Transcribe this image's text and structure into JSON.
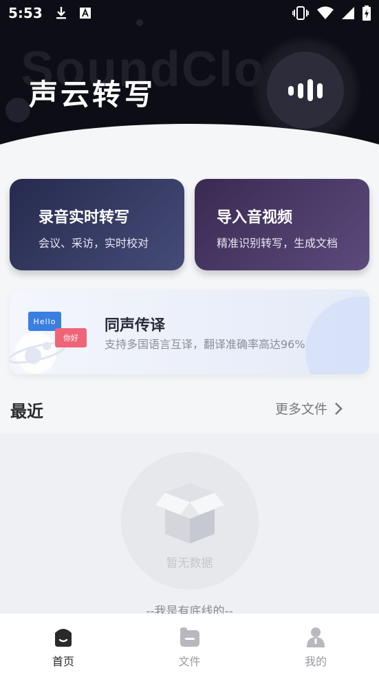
{
  "status_bar": {
    "time": "5:53",
    "icons": [
      "download-icon",
      "a-keyboard-icon",
      "vibrate-icon",
      "wifi-icon",
      "signal-icon",
      "battery-charging-icon"
    ]
  },
  "header": {
    "bg_text": "SoundCloud",
    "title": "声云转写",
    "mic_icon": "voice-bars-icon"
  },
  "cards": {
    "record": {
      "title": "录音实时转写",
      "subtitle": "会议、采访，实时校对"
    },
    "import": {
      "title": "导入音视频",
      "subtitle": "精准识别转写，生成文档"
    }
  },
  "translate": {
    "title": "同声传译",
    "subtitle": "支持多国语言互译，翻译准确率高达96%",
    "bubble_en": "Hello",
    "bubble_zh": "你好"
  },
  "recent": {
    "title": "最近",
    "more_label": "更多文件",
    "empty_text": "暂无数据",
    "bottom_text": "--我是有底线的--"
  },
  "tabs": [
    {
      "label": "首页",
      "icon": "home-icon",
      "active": true
    },
    {
      "label": "文件",
      "icon": "file-icon",
      "active": false
    },
    {
      "label": "我的",
      "icon": "profile-icon",
      "active": false
    }
  ],
  "colors": {
    "header_bg": "#0d0d16",
    "record_card": "#2e3358",
    "import_card": "#4a3a68",
    "active_tab": "#2a2a2a"
  }
}
